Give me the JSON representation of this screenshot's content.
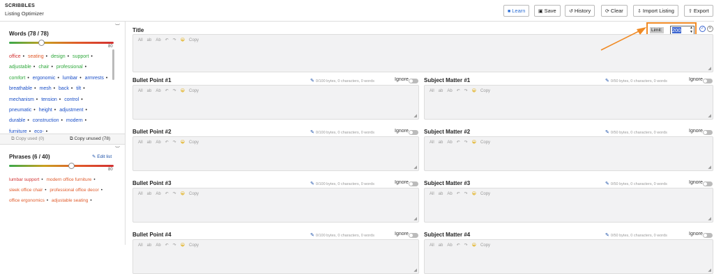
{
  "app": {
    "brand": "SCRIBBLES",
    "subtitle": "Listing Optimizer"
  },
  "toolbar": {
    "learn": "Learn",
    "save": "Save",
    "history": "History",
    "clear": "Clear",
    "import": "Import Listing",
    "export": "Export",
    "learn_color": "#2d6fd6"
  },
  "sidebar": {
    "words_title": "Words (78 / 78)",
    "words_limit": "80",
    "words": [
      {
        "t": "office",
        "c": "#d23030"
      },
      {
        "t": "seating",
        "c": "#e05a2a"
      },
      {
        "t": "design",
        "c": "#2fa83c"
      },
      {
        "t": "support",
        "c": "#2fa83c"
      },
      {
        "t": "adjustable",
        "c": "#2fa83c"
      },
      {
        "t": "chair",
        "c": "#2fa83c"
      },
      {
        "t": "professional",
        "c": "#2fa83c"
      },
      {
        "t": "comfort",
        "c": "#2fa83c"
      },
      {
        "t": "ergonomic",
        "c": "#1a4fc8"
      },
      {
        "t": "lumbar",
        "c": "#1a4fc8"
      },
      {
        "t": "armrests",
        "c": "#1a4fc8"
      },
      {
        "t": "breathable",
        "c": "#1a4fc8"
      },
      {
        "t": "mesh",
        "c": "#1a4fc8"
      },
      {
        "t": "back",
        "c": "#1a4fc8"
      },
      {
        "t": "tilt",
        "c": "#1a4fc8"
      },
      {
        "t": "mechanism",
        "c": "#1a4fc8"
      },
      {
        "t": "tension",
        "c": "#1a4fc8"
      },
      {
        "t": "control",
        "c": "#1a4fc8"
      },
      {
        "t": "pneumatic",
        "c": "#1a4fc8"
      },
      {
        "t": "height",
        "c": "#1a4fc8"
      },
      {
        "t": "adjustment",
        "c": "#1a4fc8"
      },
      {
        "t": "durable",
        "c": "#1a4fc8"
      },
      {
        "t": "construction",
        "c": "#1a4fc8"
      },
      {
        "t": "modern",
        "c": "#1a4fc8"
      },
      {
        "t": "furniture",
        "c": "#1a4fc8"
      },
      {
        "t": "eco-",
        "c": "#1a4fc8"
      }
    ],
    "copy_used": "Copy used (0)",
    "copy_unused": "Copy unused (78)",
    "phrases_title": "Phrases (6 / 40)",
    "phrases_limit": "80",
    "edit_list": "Edit list",
    "phrases": [
      {
        "t": "lumbar support",
        "c": "#d23030"
      },
      {
        "t": "modern office furniture",
        "c": "#e05a2a"
      },
      {
        "t": "sleek office chair",
        "c": "#e05a2a"
      },
      {
        "t": "professional office decor",
        "c": "#e05a2a"
      },
      {
        "t": "office ergonomics",
        "c": "#e05a2a"
      },
      {
        "t": "adjustable seating",
        "c": "#e05a2a"
      }
    ]
  },
  "editor": {
    "title_label": "Title",
    "limit_label": "Limit:",
    "limit_value": "200",
    "tools": [
      "All",
      "ab",
      "Ab",
      "↶",
      "↷",
      "😀",
      "Copy"
    ],
    "meta_bullet": "0/100 bytes, 0 characters, 0 words",
    "meta_subject": "0/50 bytes, 0 characters, 0 words",
    "ignore": "Ignore",
    "bullets": [
      "Bullet Point #1",
      "Bullet Point #2",
      "Bullet Point #3",
      "Bullet Point #4"
    ],
    "subjects": [
      "Subject Matter #1",
      "Subject Matter #2",
      "Subject Matter #3",
      "Subject Matter #4"
    ],
    "highlight_color": "#f08a24"
  }
}
